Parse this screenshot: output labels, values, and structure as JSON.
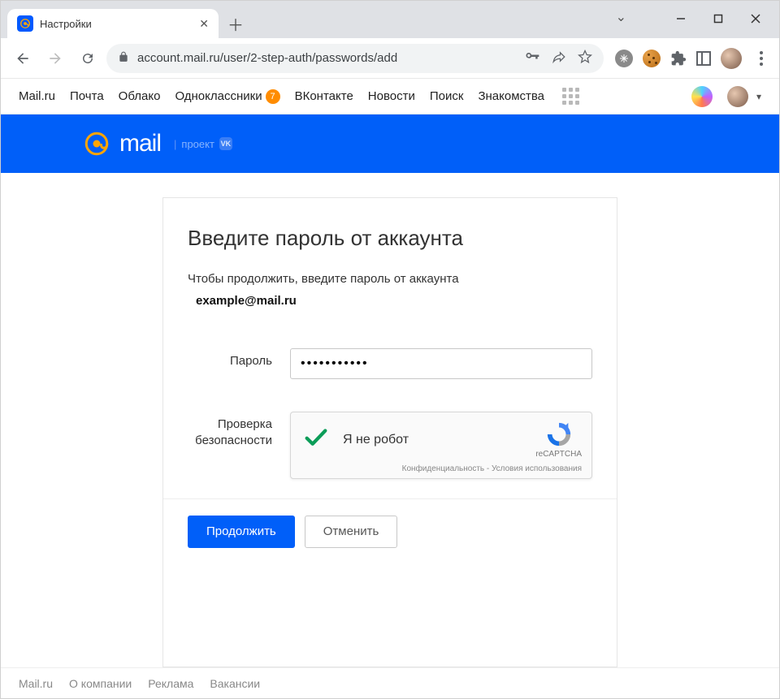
{
  "browser": {
    "tab_title": "Настройки",
    "url": "account.mail.ru/user/2-step-auth/passwords/add"
  },
  "mailru_nav": {
    "items": [
      "Mail.ru",
      "Почта",
      "Облако"
    ],
    "ok_label": "Одноклассники",
    "ok_badge": "7",
    "items2": [
      "ВКонтакте",
      "Новости",
      "Поиск",
      "Знакомства"
    ]
  },
  "header": {
    "brand": "mail",
    "project": "проект"
  },
  "form": {
    "heading": "Введите пароль от аккаунта",
    "description": "Чтобы продолжить, введите пароль от аккаунта",
    "email": "example@mail.ru",
    "password_label": "Пароль",
    "password_value": "•••••••••••",
    "security_label_l1": "Проверка",
    "security_label_l2": "безопасности",
    "captcha_text": "Я не робот",
    "recaptcha_brand": "reCAPTCHA",
    "recaptcha_links": "Конфиденциальность - Условия использования",
    "continue": "Продолжить",
    "cancel": "Отменить"
  },
  "footer": {
    "items": [
      "Mail.ru",
      "О компании",
      "Реклама",
      "Вакансии"
    ]
  }
}
